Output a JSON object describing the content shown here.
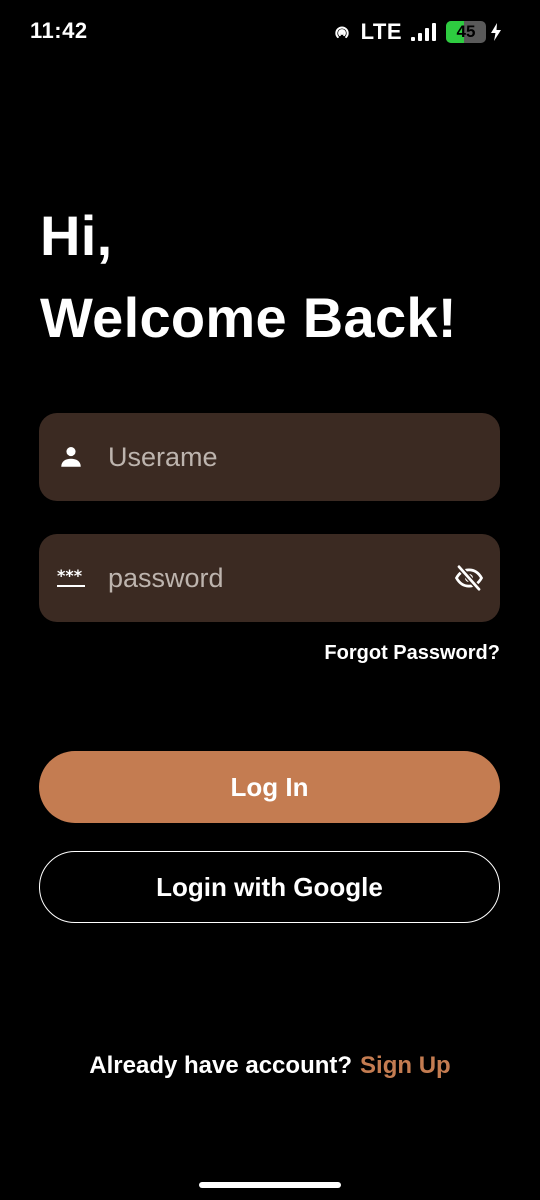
{
  "status_bar": {
    "time": "11:42",
    "network": "LTE",
    "battery_level": "45",
    "battery_fraction": 0.45,
    "icons": [
      "hotspot-icon",
      "signal-icon",
      "battery-icon",
      "charging-icon"
    ]
  },
  "greeting": {
    "line1": "Hi,",
    "line2": "Welcome Back!"
  },
  "form": {
    "username_placeholder": "Userame",
    "username_icon": "person-icon",
    "password_placeholder": "password",
    "password_icon": "password-dots-icon",
    "visibility_icon": "eye-off-icon",
    "forgot_password": "Forgot Password?"
  },
  "actions": {
    "login_label": "Log In",
    "google_label": "Login with Google"
  },
  "footer": {
    "prompt": "Already have account?",
    "signup_link": "Sign Up"
  },
  "colors": {
    "background": "#000000",
    "field_background": "#3b2a22",
    "accent": "#c47c51",
    "text": "#ffffff",
    "placeholder": "#bdb4ae"
  }
}
